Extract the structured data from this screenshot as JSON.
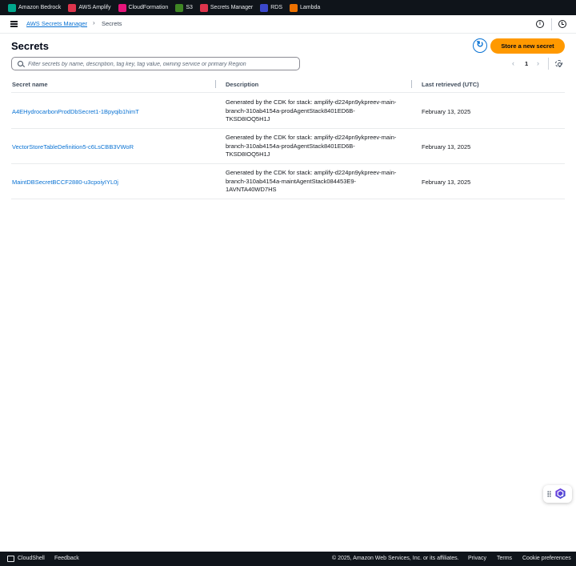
{
  "services": [
    {
      "label": "Amazon Bedrock",
      "icon": "bedrock-icon",
      "color": "#01a88d"
    },
    {
      "label": "AWS Amplify",
      "icon": "amplify-icon",
      "color": "#dd344c"
    },
    {
      "label": "CloudFormation",
      "icon": "cloudformation-icon",
      "color": "#e7157b"
    },
    {
      "label": "S3",
      "icon": "s3-icon",
      "color": "#3f8624"
    },
    {
      "label": "Secrets Manager",
      "icon": "secrets-manager-icon",
      "color": "#dd344c"
    },
    {
      "label": "RDS",
      "icon": "rds-icon",
      "color": "#3b48cc"
    },
    {
      "label": "Lambda",
      "icon": "lambda-icon",
      "color": "#ed7100"
    }
  ],
  "breadcrumb": {
    "parent": "AWS Secrets Manager",
    "separator": "›",
    "current": "Secrets"
  },
  "header": {
    "title": "Secrets",
    "primary_button": "Store a new secret"
  },
  "filter": {
    "placeholder": "Filter secrets by name, description, tag key, tag value, owning service or primary Region"
  },
  "pagination": {
    "prev": "‹",
    "page": "1",
    "next": "›"
  },
  "table": {
    "columns": [
      "Secret name",
      "Description",
      "Last retrieved (UTC)"
    ],
    "rows": [
      {
        "name": "A4EHydrocarbonProdDbSecret1-1Bpyqib1himT",
        "description": "Generated by the CDK for stack: amplify-d224pn9ykpreev-main-branch-310ab4154a-prodAgentStack8401ED6B-TKSD8IOQ5H1J",
        "last_retrieved": "February 13, 2025"
      },
      {
        "name": "VectorStoreTableDefinition5-c6LsCBB3VWoR",
        "description": "Generated by the CDK for stack: amplify-d224pn9ykpreev-main-branch-310ab4154a-prodAgentStack8401ED6B-TKSD8IOQ5H1J",
        "last_retrieved": "February 13, 2025"
      },
      {
        "name": "MaintDBSecretBCCF2880-u3cpoiyIYL0j",
        "description": "Generated by the CDK for stack: amplify-d224pn9ykpreev-main-branch-310ab4154a-maintAgentStack084453E9-1AVNTA40WD7HS",
        "last_retrieved": "February 13, 2025"
      }
    ]
  },
  "footer": {
    "cloudshell": "CloudShell",
    "feedback": "Feedback",
    "copyright": "© 2025, Amazon Web Services, Inc. or its affiliates.",
    "privacy": "Privacy",
    "terms": "Terms",
    "cookies": "Cookie preferences"
  }
}
